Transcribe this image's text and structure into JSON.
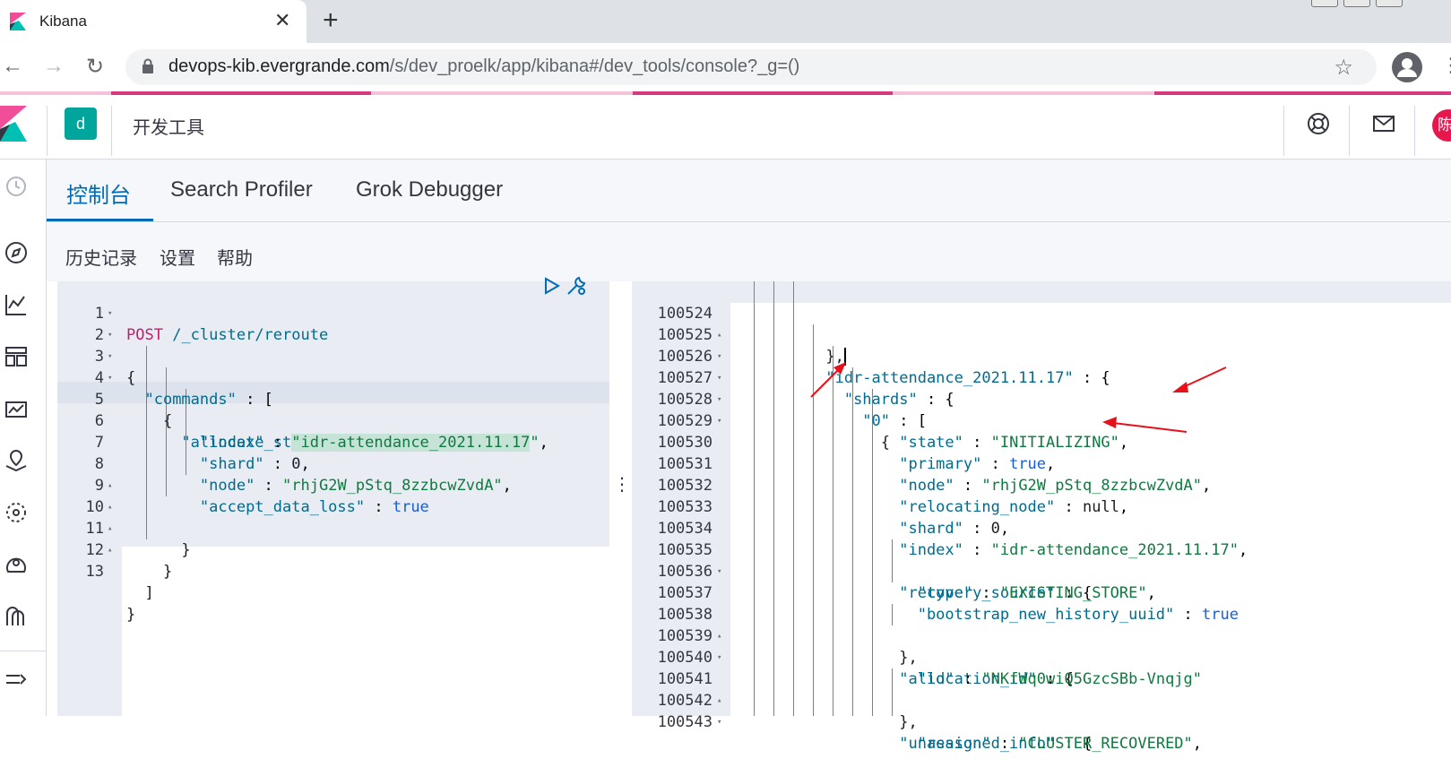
{
  "browser": {
    "tab_title": "Kibana",
    "tab_close": "✕",
    "new_tab": "+",
    "url_host": "devops-kib.evergrande.com",
    "url_rest": "/s/dev_proelk/app/kibana#/dev_tools/console?_g=()",
    "back": "←",
    "forward": "→",
    "reload": "↻",
    "star": "☆",
    "menu": "⋮"
  },
  "kibana": {
    "space_initial": "d",
    "app_title": "开发工具",
    "avatar_initial": "陈"
  },
  "tabs": [
    {
      "label": "控制台",
      "active": true
    },
    {
      "label": "Search Profiler",
      "active": false
    },
    {
      "label": "Grok Debugger",
      "active": false
    }
  ],
  "submenu": {
    "history": "历史记录",
    "settings": "设置",
    "help": "帮助"
  },
  "divider_handle": "⋮",
  "request_editor": {
    "lines": [
      {
        "n": "1",
        "fold": ""
      },
      {
        "n": "2",
        "fold": "▾"
      },
      {
        "n": "3",
        "fold": "▾"
      },
      {
        "n": "4",
        "fold": "▾"
      },
      {
        "n": "5",
        "fold": "▾"
      },
      {
        "n": "6",
        "fold": ""
      },
      {
        "n": "7",
        "fold": ""
      },
      {
        "n": "8",
        "fold": ""
      },
      {
        "n": "9",
        "fold": ""
      },
      {
        "n": "10",
        "fold": "▴"
      },
      {
        "n": "11",
        "fold": "▴"
      },
      {
        "n": "12",
        "fold": "▴"
      },
      {
        "n": "13",
        "fold": "▴"
      }
    ],
    "method": "POST",
    "path": "/_cluster/reroute",
    "key_commands": "\"commands\"",
    "key_allocate": "\"allocate_stale_primary\"",
    "key_index": "\"index\"",
    "val_index": "\"idr-attendance_2021.11.17",
    "val_index_end": "\"",
    "key_shard": "\"shard\"",
    "val_shard": "0",
    "key_node": "\"node\"",
    "val_node": "\"rhjG2W_pStq_8zzbcwZvdA\"",
    "key_accept": "\"accept_data_loss\"",
    "val_accept": "true"
  },
  "response_editor": {
    "lines": [
      {
        "n": "100524",
        "fold": "▴"
      },
      {
        "n": "100525",
        "fold": "▾"
      },
      {
        "n": "100526",
        "fold": "▾"
      },
      {
        "n": "100527",
        "fold": "▾"
      },
      {
        "n": "100528",
        "fold": "▾"
      },
      {
        "n": "100529",
        "fold": ""
      },
      {
        "n": "100530",
        "fold": ""
      },
      {
        "n": "100531",
        "fold": ""
      },
      {
        "n": "100532",
        "fold": ""
      },
      {
        "n": "100533",
        "fold": ""
      },
      {
        "n": "100534",
        "fold": ""
      },
      {
        "n": "100535",
        "fold": "▾"
      },
      {
        "n": "100536",
        "fold": ""
      },
      {
        "n": "100537",
        "fold": ""
      },
      {
        "n": "100538",
        "fold": "▴"
      },
      {
        "n": "100539",
        "fold": "▾"
      },
      {
        "n": "100540",
        "fold": ""
      },
      {
        "n": "100541",
        "fold": "▴"
      },
      {
        "n": "100542",
        "fold": "▾"
      },
      {
        "n": "100543",
        "fold": ""
      }
    ],
    "key_idx": "\"idr-attendance_2021.11.17\"",
    "key_shards": "\"shards\"",
    "key_zero": "\"0\"",
    "key_state": "\"state\"",
    "val_state": "\"INITIALIZING\"",
    "key_primary": "\"primary\"",
    "val_primary": "true",
    "key_node": "\"node\"",
    "val_node": "\"rhjG2W_pStq_8zzbcwZvdA\"",
    "key_relocating": "\"relocating_node\"",
    "val_relocating": "null",
    "key_shard": "\"shard\"",
    "val_shard": "0",
    "key_index": "\"index\"",
    "val_index": "\"idr-attendance_2021.11.17\"",
    "key_recovery": "\"recovery_source\"",
    "key_type": "\"type\"",
    "val_type": "\"EXISTING_STORE\"",
    "key_bootstrap": "\"bootstrap_new_history_uuid\"",
    "val_bootstrap": "true",
    "key_alloc_id": "\"allocation_id\"",
    "key_id": "\"id\"",
    "val_id": "\"NKfWq0wiQ5GzcSBb-Vnqjg\"",
    "key_unassigned": "\"unassigned_info\"",
    "key_reason": "\"reason\"",
    "val_reason": "\"CLUSTER_RECOVERED\""
  },
  "colors": {
    "accent": "#006bb4",
    "space_badge": "#00a69b",
    "avatar": "#e7164c",
    "annotation_arrow": "#e8101a"
  }
}
